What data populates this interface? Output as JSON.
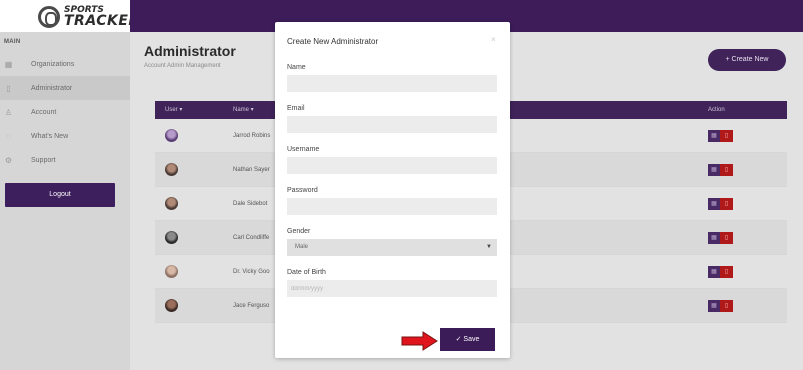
{
  "brand": {
    "line1": "SPORTS",
    "line2": "TRACKER"
  },
  "sidebar": {
    "section_label": "MAIN",
    "items": [
      {
        "label": "Organizations",
        "icon": "grid-icon"
      },
      {
        "label": "Administrator",
        "icon": "document-icon",
        "active": true
      },
      {
        "label": "Account",
        "icon": "user-icon"
      },
      {
        "label": "What's New",
        "icon": "bell-icon"
      },
      {
        "label": "Support",
        "icon": "gear-icon"
      }
    ],
    "logout_label": "Logout"
  },
  "page": {
    "title": "Administrator",
    "subtitle": "Account Admin Management",
    "create_button": "+ Create New"
  },
  "table": {
    "headers": {
      "user": "User ▾",
      "name": "Name ▾",
      "action": "Action"
    },
    "rows": [
      {
        "name": "Jarrod Robins"
      },
      {
        "name": "Nathan Sayer"
      },
      {
        "name": "Dale Sidebot"
      },
      {
        "name": "Carl Condliffe"
      },
      {
        "name": "Dr. Vicky Goo"
      },
      {
        "name": "Jace Ferguso"
      }
    ]
  },
  "modal": {
    "title": "Create New Administrator",
    "close": "×",
    "fields": {
      "name_label": "Name",
      "email_label": "Email",
      "username_label": "Username",
      "password_label": "Password",
      "gender_label": "Gender",
      "gender_value": "Male",
      "dob_label": "Date of Birth",
      "dob_placeholder": "dd/mm/yyyy"
    },
    "save_label": "✓  Save"
  },
  "colors": {
    "topbar": "#3d1c59",
    "primary": "#3f2359",
    "danger": "#b01919",
    "arrow": "#e0141c"
  }
}
